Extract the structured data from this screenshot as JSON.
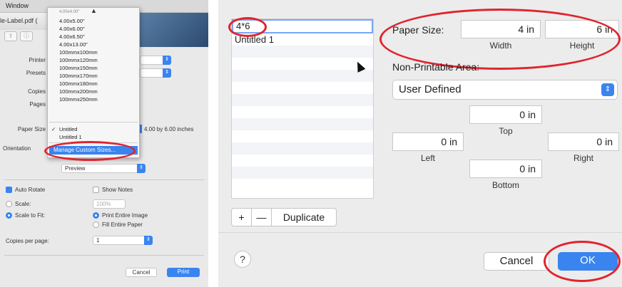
{
  "left_panel": {
    "menubar_title": "Window",
    "filename": "le-Label.pdf (",
    "labels": {
      "printer": "Printer",
      "presets": "Presets",
      "copies": "Copies",
      "pages": "Pages",
      "paper_size": "Paper Size",
      "orientation": "Orientation"
    },
    "paper_size_value": "4.00 by 6.00 inches",
    "section_select": "Preview",
    "auto_rotate": "Auto Rotate",
    "show_notes": "Show Notes",
    "scale": "Scale:",
    "scale_value": "100%",
    "scale_to_fit": "Scale to Fit:",
    "print_entire_image": "Print Entire Image",
    "fill_entire_paper": "Fill Entire Paper",
    "copies_per_page": "Copies per page:",
    "copies_per_page_value": "1",
    "cancel": "Cancel",
    "print": "Print",
    "menu": {
      "scroll_up": "▲",
      "items": [
        "4.00x4.00\"",
        "4.00x5.00\"",
        "4.00x6.00\"",
        "4.00x6.50\"",
        "4.00x13.00\"",
        "100mmx100mm",
        "100mmx120mm",
        "100mmx150mm",
        "100mmx170mm",
        "100mmx180mm",
        "100mmx200mm",
        "100mmx250mm"
      ],
      "selected_check": "✓",
      "custom_items": [
        "Untitled",
        "Untitled 1"
      ],
      "manage": "Manage Custom Sizes..."
    }
  },
  "right_panel": {
    "sizes_list": [
      "4*6",
      "Untitled 1"
    ],
    "paper_size_label": "Paper Size:",
    "width_value": "4 in",
    "height_value": "6 in",
    "width_label": "Width",
    "height_label": "Height",
    "non_printable_label": "Non-Printable Area:",
    "non_printable_value": "User Defined",
    "margin_top": "0 in",
    "margin_left": "0 in",
    "margin_right": "0 in",
    "margin_bottom": "0 in",
    "top_label": "Top",
    "left_label": "Left",
    "right_label": "Right",
    "bottom_label": "Bottom",
    "add": "+",
    "remove": "—",
    "duplicate": "Duplicate",
    "help": "?",
    "cancel": "Cancel",
    "ok": "OK"
  },
  "colors": {
    "accent": "#3a84f0",
    "highlight_ring": "#e0242e"
  }
}
